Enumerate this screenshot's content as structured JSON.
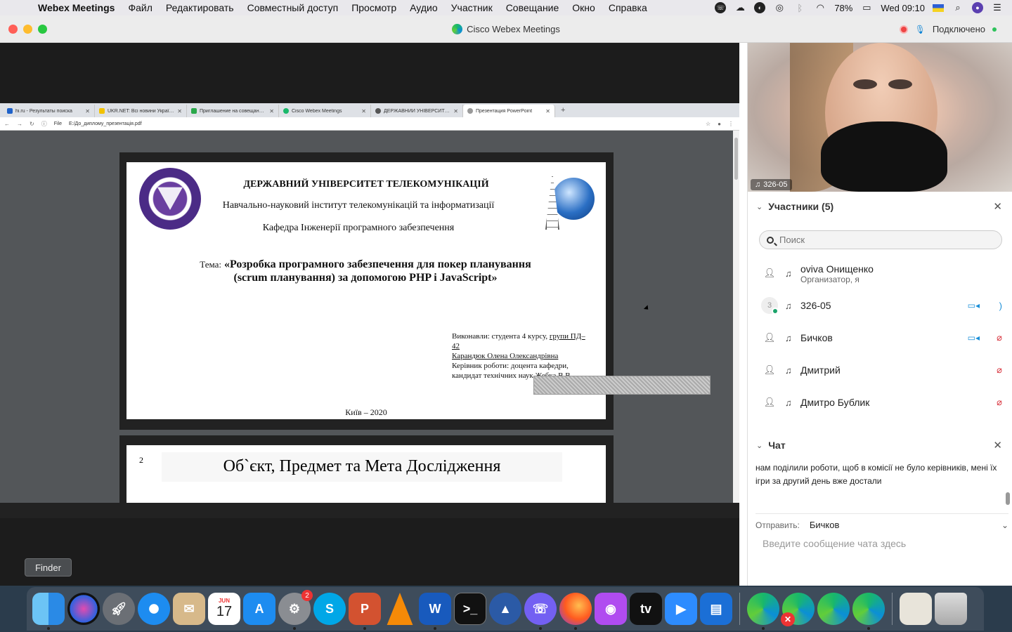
{
  "menubar": {
    "app_name": "Webex Meetings",
    "items": [
      "Файл",
      "Редактировать",
      "Совместный доступ",
      "Просмотр",
      "Аудио",
      "Участник",
      "Совещание",
      "Окно",
      "Справка"
    ],
    "battery": "78%",
    "clock": "Wed 09:10"
  },
  "window": {
    "title": "Cisco Webex Meetings",
    "status": "Подключено"
  },
  "browser": {
    "tabs": [
      {
        "label": "hi.ru - Результаты поиска"
      },
      {
        "label": "UKR.NET: Всі новини України, с"
      },
      {
        "label": "Приглашение на совещание W"
      },
      {
        "label": "Cisco Webex Meetings"
      },
      {
        "label": "ДЕРЖАВНИЙ УНІВЕРСИТЕТ ТЕЛ"
      },
      {
        "label": "Презентация PowerPoint"
      }
    ],
    "url_scheme": "File",
    "url": "E:/До_диплому_презентація.pdf"
  },
  "slide1": {
    "university": "ДЕРЖАВНИЙ УНІВЕРСИТЕТ ТЕЛЕКОМУНІКАЦІЙ",
    "institute": "Навчально-науковий інститут телекомунікацій та інформатизації",
    "department": "Кафедра Інженерії програмного забезпечення",
    "topic_label": "Тема:",
    "topic_line1": "«Розробка програмного забезпечення для покер планування",
    "topic_line2": "(scrum планування) за допомогою PHP  і  JavaScript»",
    "authors_line1": "Виконавли: студента 4 курсу,",
    "authors_group": "групи ПД–42",
    "authors_name": "Карандюк Олена Олександрівна",
    "supervisor_line1": "Керівник роботи: доцента кафедри,",
    "supervisor_line2": "кандидат технічних наук",
    "supervisor_name": "Жебка В.В.",
    "city_year": "Київ – 2020"
  },
  "slide2": {
    "number": "2",
    "heading": "Об`єкт, Предмет та Мета Дослідження"
  },
  "panel": {
    "video_label": "326-05",
    "participants_header": "Участники (5)",
    "search_placeholder": "Поиск",
    "participants": [
      {
        "name": "oviva Онищенко",
        "role": "Организатор, я"
      },
      {
        "name": "326-05",
        "avatar_text": "3"
      },
      {
        "name": "Бичков"
      },
      {
        "name": "Дмитрий"
      },
      {
        "name": "Дмитро Бублик"
      }
    ],
    "chat_header": "Чат",
    "chat_message": "нам поділили роботи, щоб в комісії не було керівників, мені їх ігри за другий день вже достали",
    "send_to_label": "Отправить:",
    "send_to_value": "Бичков",
    "chat_placeholder": "Введите сообщение чата здесь"
  },
  "dock": {
    "tooltip": "Finder",
    "calendar_month": "JUN",
    "calendar_day": "17",
    "settings_badge": "2",
    "skype_letter": "S",
    "powerpoint_letter": "P",
    "word_letter": "W"
  }
}
